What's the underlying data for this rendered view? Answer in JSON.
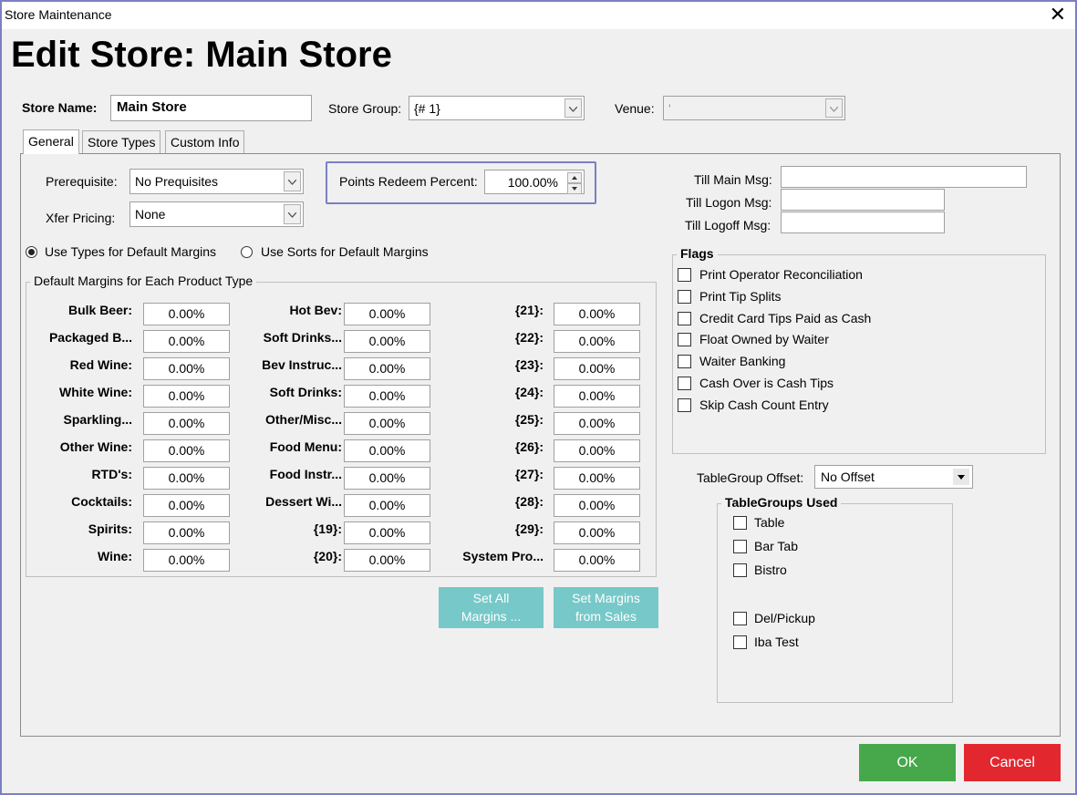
{
  "window": {
    "title": "Store  Maintenance",
    "close_glyph": "✕"
  },
  "heading": "Edit Store: Main Store",
  "store": {
    "name_label": "Store Name:",
    "name_value": "Main Store",
    "group_label": "Store Group:",
    "group_value": "{# 1}",
    "venue_label": "Venue:",
    "venue_value": "'"
  },
  "tabs": [
    "General",
    "Store Types",
    "Custom Info"
  ],
  "general": {
    "prerequisite_label": "Prerequisite:",
    "prerequisite_value": "No Prequisites",
    "xfer_label": "Xfer Pricing:",
    "xfer_value": "None",
    "points_label": "Points Redeem Percent:",
    "points_value": "100.00%",
    "radio_types": "Use Types for Default Margins",
    "radio_sorts": "Use Sorts for Default Margins",
    "margins_title": "Default Margins for Each Product Type",
    "col1": [
      {
        "label": "Bulk Beer:",
        "value": "0.00%"
      },
      {
        "label": "Packaged B...",
        "value": "0.00%"
      },
      {
        "label": "Red Wine:",
        "value": "0.00%"
      },
      {
        "label": "White Wine:",
        "value": "0.00%"
      },
      {
        "label": "Sparkling...",
        "value": "0.00%"
      },
      {
        "label": "Other Wine:",
        "value": "0.00%"
      },
      {
        "label": "RTD's:",
        "value": "0.00%"
      },
      {
        "label": "Cocktails:",
        "value": "0.00%"
      },
      {
        "label": "Spirits:",
        "value": "0.00%"
      },
      {
        "label": "Wine:",
        "value": "0.00%"
      }
    ],
    "col2": [
      {
        "label": "Hot Bev:",
        "value": "0.00%"
      },
      {
        "label": "Soft Drinks...",
        "value": "0.00%"
      },
      {
        "label": "Bev Instruc...",
        "value": "0.00%"
      },
      {
        "label": "Soft Drinks:",
        "value": "0.00%"
      },
      {
        "label": "Other/Misc...",
        "value": "0.00%"
      },
      {
        "label": "Food Menu:",
        "value": "0.00%"
      },
      {
        "label": "Food Instr...",
        "value": "0.00%"
      },
      {
        "label": "Dessert Wi...",
        "value": "0.00%"
      },
      {
        "label": "{19}:",
        "value": "0.00%"
      },
      {
        "label": "{20}:",
        "value": "0.00%"
      }
    ],
    "col3": [
      {
        "label": "{21}:",
        "value": "0.00%"
      },
      {
        "label": "{22}:",
        "value": "0.00%"
      },
      {
        "label": "{23}:",
        "value": "0.00%"
      },
      {
        "label": "{24}:",
        "value": "0.00%"
      },
      {
        "label": "{25}:",
        "value": "0.00%"
      },
      {
        "label": "{26}:",
        "value": "0.00%"
      },
      {
        "label": "{27}:",
        "value": "0.00%"
      },
      {
        "label": "{28}:",
        "value": "0.00%"
      },
      {
        "label": "{29}:",
        "value": "0.00%"
      },
      {
        "label": "System Pro...",
        "value": "0.00%"
      }
    ],
    "set_all_line1": "Set All",
    "set_all_line2": "Margins ...",
    "set_sales_line1": "Set Margins",
    "set_sales_line2": "from Sales",
    "till_main_label": "Till Main Msg:",
    "till_logon_label": "Till Logon Msg:",
    "till_logoff_label": "Till Logoff Msg:",
    "flags_title": "Flags",
    "flags": [
      "Print Operator Reconciliation",
      "Print Tip Splits",
      "Credit Card Tips Paid as Cash",
      "Float Owned by Waiter",
      "Waiter Banking",
      "Cash Over is Cash Tips",
      "Skip Cash Count Entry"
    ],
    "tablegroup_offset_label": "TableGroup Offset:",
    "tablegroup_offset_value": "No Offset",
    "tablegroups_title": "TableGroups Used",
    "tablegroups": [
      "Table",
      "Bar Tab",
      "Bistro",
      "Del/Pickup",
      "Iba Test"
    ]
  },
  "buttons": {
    "ok": "OK",
    "cancel": "Cancel"
  },
  "colors": {
    "ok": "#46a84b",
    "cancel": "#e3272e",
    "teal": "#77c8c8",
    "border_accent": "#7b7fc2"
  }
}
